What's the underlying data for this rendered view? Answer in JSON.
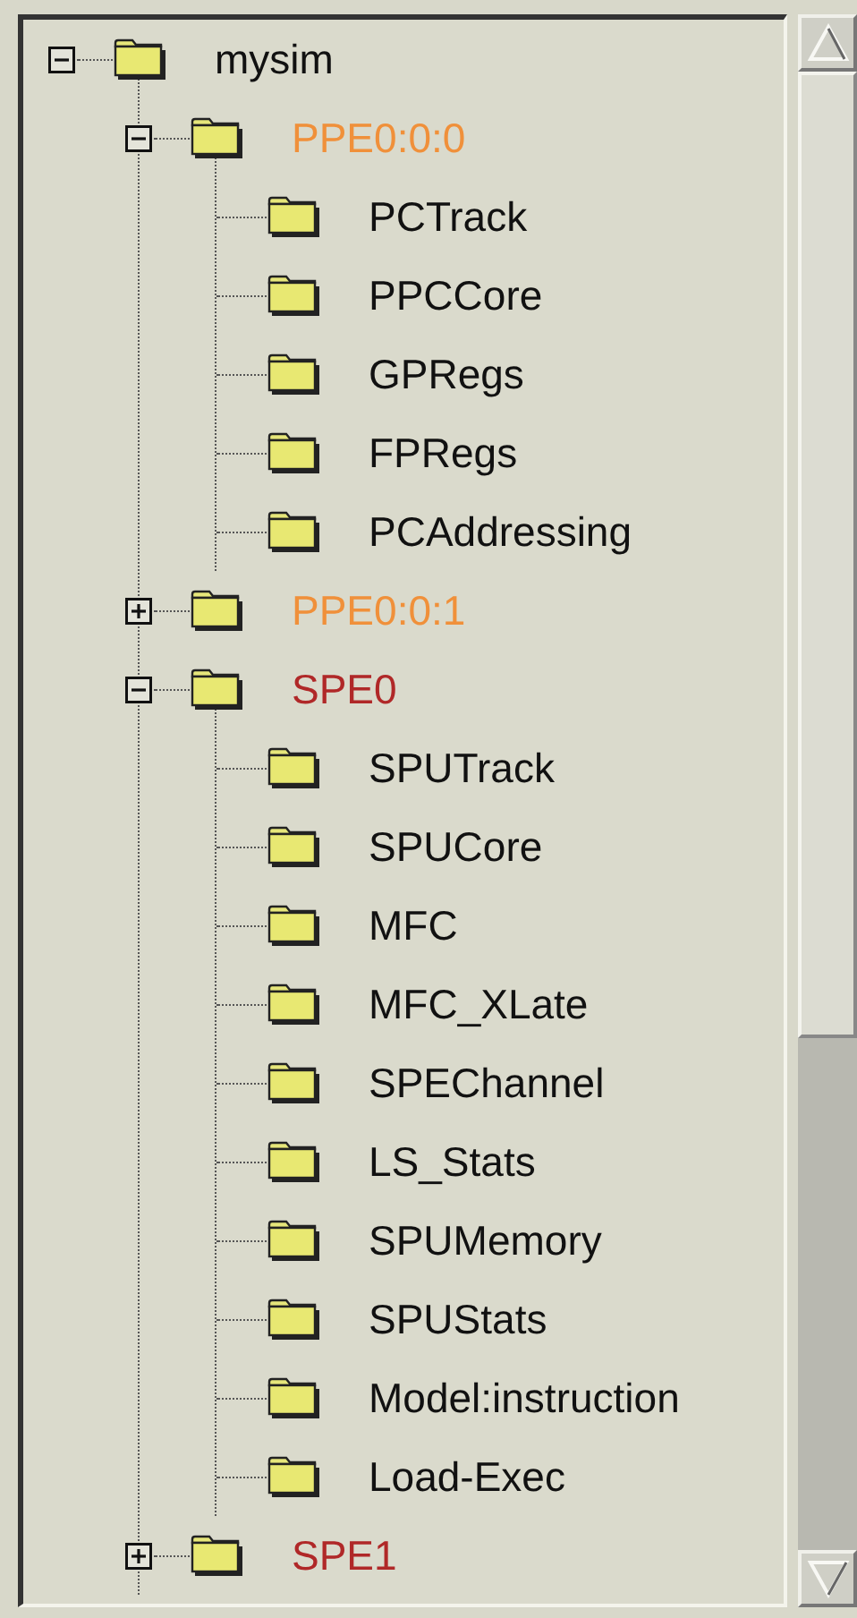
{
  "tree": {
    "items": [
      {
        "label": "mysim",
        "expanded": true,
        "children": [
          {
            "label": "PPE0:0:0",
            "color": "#f0903a",
            "expanded": true,
            "children": [
              {
                "label": "PCTrack"
              },
              {
                "label": "PPCCore"
              },
              {
                "label": "GPRegs"
              },
              {
                "label": "FPRegs"
              },
              {
                "label": "PCAddressing"
              }
            ]
          },
          {
            "label": "PPE0:0:1",
            "color": "#f0903a",
            "expanded": false
          },
          {
            "label": "SPE0",
            "color": "#b02828",
            "expanded": true,
            "children": [
              {
                "label": "SPUTrack"
              },
              {
                "label": "SPUCore"
              },
              {
                "label": "MFC"
              },
              {
                "label": "MFC_XLate"
              },
              {
                "label": "SPEChannel"
              },
              {
                "label": "LS_Stats"
              },
              {
                "label": "SPUMemory"
              },
              {
                "label": "SPUStats"
              },
              {
                "label": "Model:instruction"
              },
              {
                "label": "Load-Exec"
              }
            ]
          },
          {
            "label": "SPE1",
            "color": "#b02828",
            "expanded": false
          }
        ]
      }
    ]
  }
}
